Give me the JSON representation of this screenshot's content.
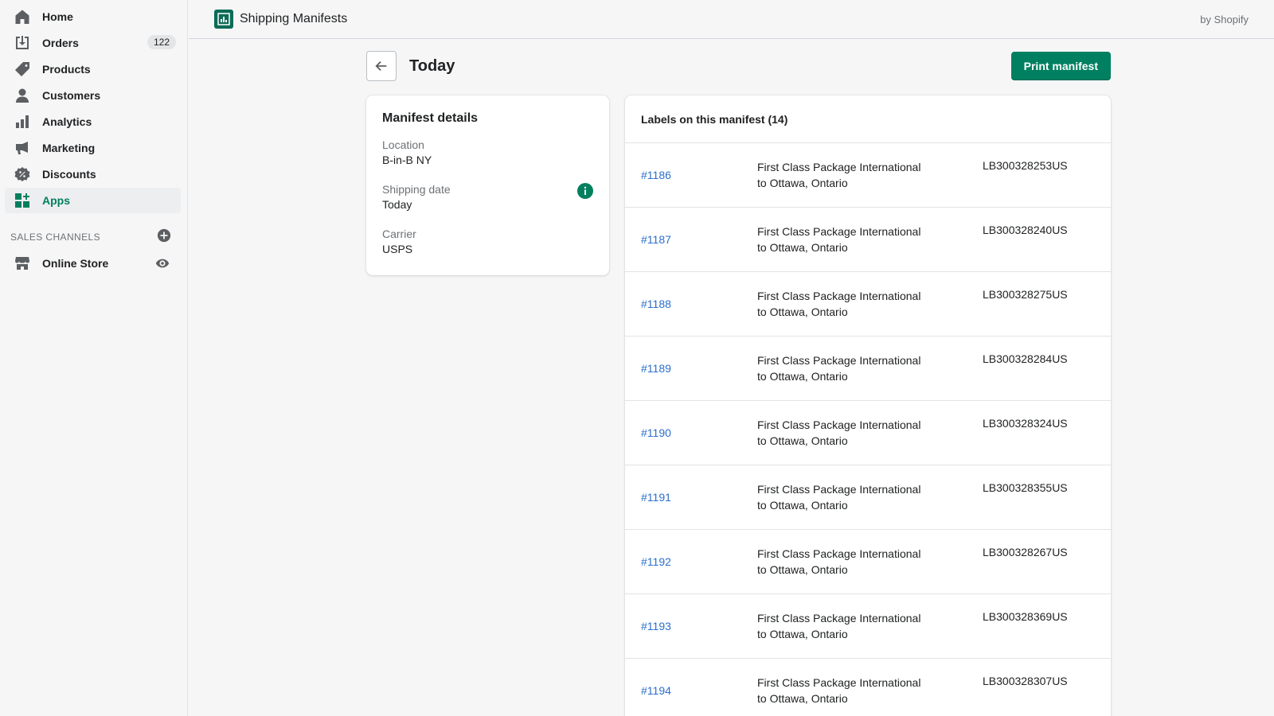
{
  "sidebar": {
    "items": [
      {
        "label": "Home",
        "icon": "home-icon"
      },
      {
        "label": "Orders",
        "icon": "orders-icon",
        "badge": "122"
      },
      {
        "label": "Products",
        "icon": "tag-icon"
      },
      {
        "label": "Customers",
        "icon": "person-icon"
      },
      {
        "label": "Analytics",
        "icon": "bar-chart-icon"
      },
      {
        "label": "Marketing",
        "icon": "megaphone-icon"
      },
      {
        "label": "Discounts",
        "icon": "discount-icon"
      },
      {
        "label": "Apps",
        "icon": "apps-icon",
        "active": true
      }
    ],
    "sales_channels": {
      "title": "SALES CHANNELS",
      "items": [
        {
          "label": "Online Store",
          "icon": "store-icon"
        }
      ]
    }
  },
  "topbar": {
    "app_title": "Shipping Manifests",
    "by": "by Shopify"
  },
  "page": {
    "title": "Today",
    "print_button": "Print manifest"
  },
  "details": {
    "title": "Manifest details",
    "location_label": "Location",
    "location_value": "B-in-B NY",
    "shipping_date_label": "Shipping date",
    "shipping_date_value": "Today",
    "carrier_label": "Carrier",
    "carrier_value": "USPS"
  },
  "labels": {
    "title": "Labels on this manifest (14)",
    "rows": [
      {
        "order": "#1186",
        "service": "First Class Package International",
        "destination": "to Ottawa, Ontario",
        "tracking": "LB300328253US"
      },
      {
        "order": "#1187",
        "service": "First Class Package International",
        "destination": "to Ottawa, Ontario",
        "tracking": "LB300328240US"
      },
      {
        "order": "#1188",
        "service": "First Class Package International",
        "destination": "to Ottawa, Ontario",
        "tracking": "LB300328275US"
      },
      {
        "order": "#1189",
        "service": "First Class Package International",
        "destination": "to Ottawa, Ontario",
        "tracking": "LB300328284US"
      },
      {
        "order": "#1190",
        "service": "First Class Package International",
        "destination": "to Ottawa, Ontario",
        "tracking": "LB300328324US"
      },
      {
        "order": "#1191",
        "service": "First Class Package International",
        "destination": "to Ottawa, Ontario",
        "tracking": "LB300328355US"
      },
      {
        "order": "#1192",
        "service": "First Class Package International",
        "destination": "to Ottawa, Ontario",
        "tracking": "LB300328267US"
      },
      {
        "order": "#1193",
        "service": "First Class Package International",
        "destination": "to Ottawa, Ontario",
        "tracking": "LB300328369US"
      },
      {
        "order": "#1194",
        "service": "First Class Package International",
        "destination": "to Ottawa, Ontario",
        "tracking": "LB300328307US"
      }
    ]
  },
  "colors": {
    "accent": "#008060",
    "link": "#2c6ecb",
    "active_nav": "#007f5f"
  }
}
